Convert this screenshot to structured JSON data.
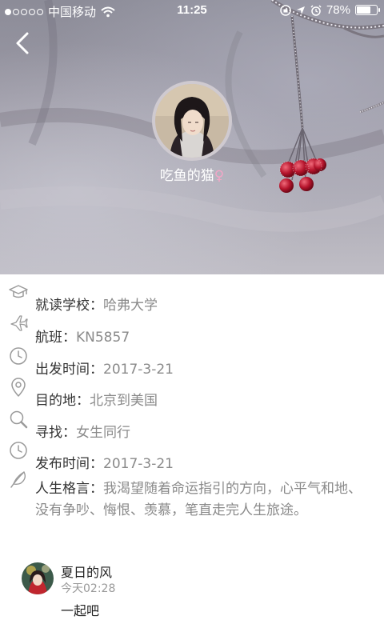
{
  "status_bar": {
    "carrier": "中国移动",
    "time": "11:25",
    "battery_percent": "78%",
    "battery_level": 0.78,
    "signal_bars_filled": 1,
    "signal_bars_total": 5
  },
  "profile": {
    "nickname": "吃鱼的猫",
    "gender_symbol": "♀"
  },
  "info": {
    "school": {
      "label": "就读学校：",
      "value": "哈弗大学"
    },
    "flight": {
      "label": "航班：",
      "value": "KN5857"
    },
    "departure": {
      "label": "出发时间：",
      "value": "2017-3-21"
    },
    "destination": {
      "label": "目的地：",
      "value": "北京到美国"
    },
    "seeking": {
      "label": "寻找：",
      "value": "女生同行"
    },
    "published": {
      "label": "发布时间：",
      "value": "2017-3-21"
    },
    "motto": {
      "label": "人生格言：",
      "value": "我渴望随着命运指引的方向，心平气和地、没有争吵、悔恨、羡慕，笔直走完人生旅途。"
    }
  },
  "comment": {
    "author": "夏日的风",
    "time": "今天02:28",
    "text": "一起吧"
  },
  "colors": {
    "label_text": "#333333",
    "value_text": "#8a8a8a",
    "icon_gray": "#9a9a9a",
    "female_pink": "#f3a6c7"
  }
}
